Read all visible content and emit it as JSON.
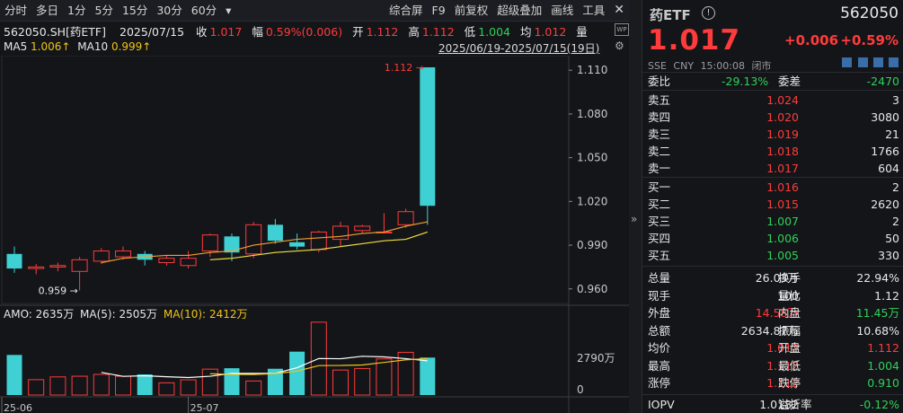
{
  "toolbar": {
    "items": [
      "分时",
      "多日",
      "1分",
      "5分",
      "15分",
      "30分",
      "60分"
    ],
    "dropdown": "▾",
    "right_items": [
      "综合屏",
      "F9",
      "前复权",
      "超级叠加",
      "画线",
      "工具"
    ]
  },
  "info": {
    "code": "562050.SH[药ETF]",
    "date": "2025/07/15",
    "close_label": "收",
    "close": "1.017",
    "amp_label": "幅",
    "amp": "0.59%(0.006)",
    "open_label": "开",
    "open": "1.112",
    "high_label": "高",
    "high": "1.112",
    "low_label": "低",
    "low": "1.004",
    "avg_label": "均",
    "avg": "1.012",
    "vol_label": "量"
  },
  "ma": {
    "ma5_label": "MA5",
    "ma5": "1.006↑",
    "ma10_label": "MA10",
    "ma10": "0.999↑"
  },
  "date_range": "2025/06/19-2025/07/15(19日)",
  "colors": {
    "up": "#ff3b3b",
    "down": "#3fd0d4",
    "ma5": "#ffffff",
    "ma10": "#f0c419",
    "bg": "#141519"
  },
  "chart_data": {
    "type": "candlestick",
    "y_ticks": [
      "1.110",
      "1.080",
      "1.050",
      "1.020",
      "0.990",
      "0.960"
    ],
    "ylim": [
      0.95,
      1.12
    ],
    "annotations": {
      "high_label": "1.112",
      "low_label": "0.959"
    },
    "x_labels": [
      "25-06",
      "25-07"
    ],
    "candles": [
      {
        "o": 0.984,
        "c": 0.974,
        "h": 0.989,
        "l": 0.971
      },
      {
        "o": 0.974,
        "c": 0.975,
        "h": 0.977,
        "l": 0.97
      },
      {
        "o": 0.975,
        "c": 0.976,
        "h": 0.978,
        "l": 0.972
      },
      {
        "o": 0.972,
        "c": 0.98,
        "h": 0.982,
        "l": 0.959
      },
      {
        "o": 0.979,
        "c": 0.986,
        "h": 0.988,
        "l": 0.977
      },
      {
        "o": 0.982,
        "c": 0.986,
        "h": 0.989,
        "l": 0.98
      },
      {
        "o": 0.984,
        "c": 0.98,
        "h": 0.986,
        "l": 0.976
      },
      {
        "o": 0.978,
        "c": 0.981,
        "h": 0.983,
        "l": 0.976
      },
      {
        "o": 0.976,
        "c": 0.981,
        "h": 0.986,
        "l": 0.974
      },
      {
        "o": 0.986,
        "c": 0.997,
        "h": 0.998,
        "l": 0.982
      },
      {
        "o": 0.996,
        "c": 0.985,
        "h": 0.998,
        "l": 0.979
      },
      {
        "o": 0.984,
        "c": 1.004,
        "h": 1.006,
        "l": 0.981
      },
      {
        "o": 1.004,
        "c": 0.993,
        "h": 1.008,
        "l": 0.991
      },
      {
        "o": 0.992,
        "c": 0.989,
        "h": 0.998,
        "l": 0.987
      },
      {
        "o": 0.987,
        "c": 0.999,
        "h": 1.0,
        "l": 0.985
      },
      {
        "o": 0.994,
        "c": 1.003,
        "h": 1.006,
        "l": 0.989
      },
      {
        "o": 1.0,
        "c": 1.003,
        "h": 1.004,
        "l": 0.998
      },
      {
        "o": 0.999,
        "c": 0.999,
        "h": 1.012,
        "l": 0.998
      },
      {
        "o": 1.004,
        "c": 1.013,
        "h": 1.015,
        "l": 1.002
      },
      {
        "o": 1.112,
        "c": 1.017,
        "h": 1.112,
        "l": 1.004
      }
    ],
    "ma5": [
      null,
      null,
      null,
      null,
      0.978,
      0.981,
      0.982,
      0.983,
      0.983,
      0.985,
      0.986,
      0.99,
      0.992,
      0.994,
      0.995,
      0.996,
      0.998,
      0.999,
      1.003,
      1.006
    ],
    "ma10": [
      null,
      null,
      null,
      null,
      null,
      null,
      null,
      null,
      null,
      0.98,
      0.981,
      0.983,
      0.985,
      0.986,
      0.987,
      0.989,
      0.991,
      0.993,
      0.994,
      0.999
    ],
    "volume": {
      "label_amo": "AMO:",
      "amo": "2635万",
      "label_ma5": "MA(5):",
      "ma5": "2505万",
      "label_ma10": "MA(10):",
      "ma10": "2412万",
      "y_ticks": [
        "2790万",
        "0"
      ],
      "ylim": [
        0,
        5600
      ],
      "values": [
        3050,
        1170,
        1380,
        1430,
        1570,
        1430,
        1570,
        930,
        1160,
        1970,
        2040,
        1070,
        2000,
        3300,
        5540,
        1900,
        2020,
        2750,
        3250,
        2850
      ],
      "ma5_line": [
        null,
        null,
        null,
        null,
        1720,
        1420,
        1470,
        1390,
        1330,
        1430,
        1650,
        1650,
        1650,
        2080,
        2780,
        2760,
        2950,
        2900,
        2770,
        2600
      ],
      "ma10_line": [
        null,
        null,
        null,
        null,
        null,
        null,
        null,
        null,
        null,
        1620,
        1570,
        1560,
        1630,
        1820,
        2240,
        2250,
        2290,
        2480,
        2680,
        2770
      ]
    }
  },
  "quote": {
    "name": "药ETF",
    "code": "562050",
    "price": "1.017",
    "change": "+0.006",
    "pct": "+0.59%",
    "exchange": "SSE",
    "currency": "CNY",
    "time": "15:00:08",
    "status": "闭市",
    "weibi_label": "委比",
    "weibi": "-29.13%",
    "weicha_label": "委差",
    "weicha": "-2470",
    "asks": [
      {
        "label": "卖五",
        "price": "1.024",
        "vol": "3"
      },
      {
        "label": "卖四",
        "price": "1.020",
        "vol": "3080"
      },
      {
        "label": "卖三",
        "price": "1.019",
        "vol": "21"
      },
      {
        "label": "卖二",
        "price": "1.018",
        "vol": "1766"
      },
      {
        "label": "卖一",
        "price": "1.017",
        "vol": "604"
      }
    ],
    "bids": [
      {
        "label": "买一",
        "price": "1.016",
        "vol": "2"
      },
      {
        "label": "买二",
        "price": "1.015",
        "vol": "2620"
      },
      {
        "label": "买三",
        "price": "1.007",
        "vol": "2"
      },
      {
        "label": "买四",
        "price": "1.006",
        "vol": "50"
      },
      {
        "label": "买五",
        "price": "1.005",
        "vol": "330"
      }
    ],
    "stats": [
      {
        "l1": "总量",
        "v1": "26.03万",
        "c1": "white",
        "l2": "换手",
        "v2": "22.94%",
        "c2": "white"
      },
      {
        "l1": "现手",
        "v1": "100",
        "c1": "white",
        "l2": "量比",
        "v2": "1.12",
        "c2": "white"
      },
      {
        "l1": "外盘",
        "v1": "14.58万",
        "c1": "red",
        "l2": "内盘",
        "v2": "11.45万",
        "c2": "green"
      },
      {
        "l1": "总额",
        "v1": "2634.87万",
        "c1": "white",
        "l2": "振幅",
        "v2": "10.68%",
        "c2": "white"
      },
      {
        "l1": "均价",
        "v1": "1.012",
        "c1": "red",
        "l2": "开盘",
        "v2": "1.112",
        "c2": "red"
      },
      {
        "l1": "最高",
        "v1": "1.112",
        "c1": "red",
        "l2": "最低",
        "v2": "1.004",
        "c2": "green"
      },
      {
        "l1": "涨停",
        "v1": "1.112",
        "c1": "red",
        "l2": "跌停",
        "v2": "0.910",
        "c2": "green"
      }
    ],
    "iopv_label": "IOPV",
    "iopv": "1.0182",
    "premium_label": "溢折率",
    "premium": "-0.12%"
  }
}
